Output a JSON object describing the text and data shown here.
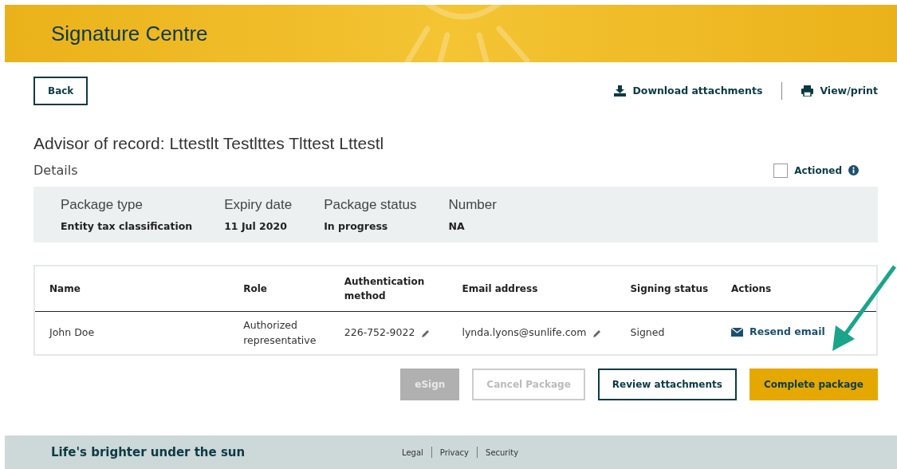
{
  "header": {
    "title": "Signature Centre"
  },
  "toolbar": {
    "back": "Back",
    "links": [
      {
        "label": "Download attachments",
        "kind": "download"
      },
      {
        "label": "View/print",
        "kind": "print"
      }
    ]
  },
  "advisor": "Advisor of record: Lttestlt Testlttes Tlttest Lttestl",
  "details_heading": "Details",
  "actioned": {
    "label": "Actioned",
    "checked": false
  },
  "details": [
    {
      "label": "Package type",
      "value": "Entity tax classification"
    },
    {
      "label": "Expiry date",
      "value": "11 Jul 2020"
    },
    {
      "label": "Package status",
      "value": "In progress"
    },
    {
      "label": "Number",
      "value": "NA"
    }
  ],
  "table": {
    "columns": [
      "Name",
      "Role",
      "Authentication method",
      "Email address",
      "Signing status",
      "Actions"
    ],
    "rows": [
      {
        "name": "John Doe",
        "role": "Authorized representative",
        "auth": "226-752-9022",
        "email": "lynda.lyons@sunlife.com",
        "status": "Signed",
        "action": "Resend email"
      }
    ]
  },
  "buttons": [
    {
      "label": "eSign",
      "kind": "filled",
      "disabled": true
    },
    {
      "label": "Cancel Package",
      "kind": "outline",
      "disabled": true
    },
    {
      "label": "Review attachments",
      "kind": "outline",
      "disabled": false
    },
    {
      "label": "Complete package",
      "kind": "primary",
      "disabled": false
    }
  ],
  "footer": {
    "tagline": "Life's brighter under the sun",
    "links": [
      "Legal",
      "Privacy",
      "Security"
    ]
  }
}
